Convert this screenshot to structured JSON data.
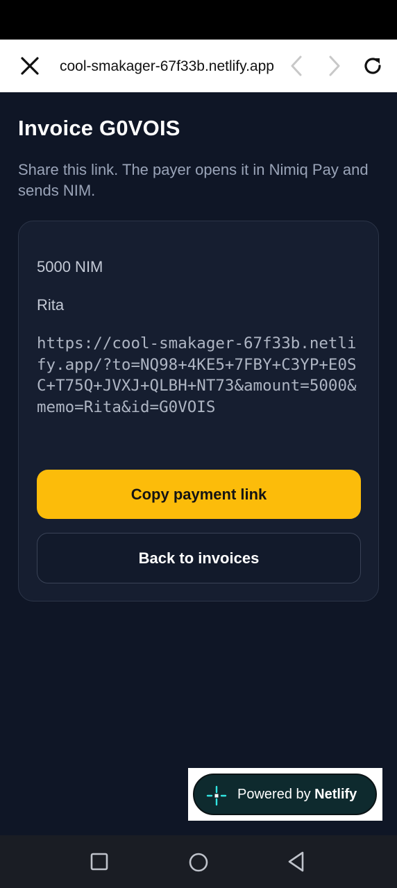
{
  "browser": {
    "url": "cool-smakager-67f33b.netlify.app"
  },
  "page": {
    "title": "Invoice G0VOIS",
    "subtitle": "Share this link. The payer opens it in Nimiq Pay and sends NIM."
  },
  "invoice": {
    "amount": "5000 NIM",
    "memo": "Rita",
    "payment_link": "https://cool-smakager-67f33b.netlify.app/?to=NQ98+4KE5+7FBY+C3YP+E0SC+T75Q+JVXJ+QLBH+NT73&amount=5000&memo=Rita&id=G0VOIS"
  },
  "actions": {
    "copy_label": "Copy payment link",
    "back_label": "Back to invoices"
  },
  "badge": {
    "prefix": "Powered by ",
    "brand": "Netlify"
  },
  "colors": {
    "accent": "#fcbc0a",
    "background": "#0f1626",
    "card": "#161e30",
    "netlify_teal": "#32e6e2"
  }
}
